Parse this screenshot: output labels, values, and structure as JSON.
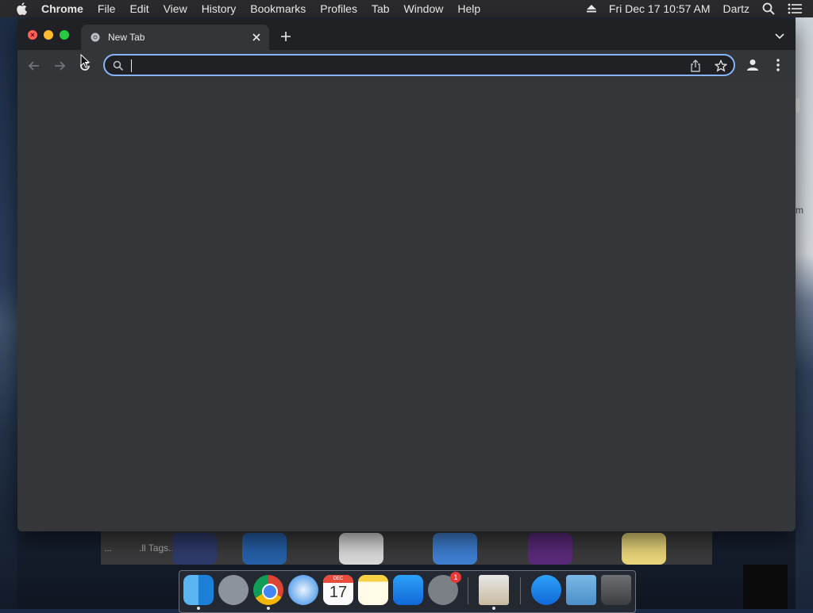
{
  "menubar": {
    "app": "Chrome",
    "items": [
      "File",
      "Edit",
      "View",
      "History",
      "Bookmarks",
      "Profiles",
      "Tab",
      "Window",
      "Help"
    ],
    "clock": "Fri Dec 17  10:57 AM",
    "user": "Dartz"
  },
  "browser": {
    "tab_title": "New Tab",
    "address_value": "",
    "accent_color": "#8ab4f8"
  },
  "background_window": {
    "label1": "...",
    "label2": ".ll Tags..."
  },
  "desktop": {
    "right_text": "m"
  },
  "dock": {
    "items": [
      "finder-icon",
      "launchpad-icon",
      "chrome-icon",
      "safari-icon",
      "calendar-icon",
      "notes-icon",
      "app-store-icon",
      "system-preferences-icon",
      "document-icon",
      "app-store-folder-icon",
      "folder-icon",
      "trash-icon"
    ],
    "calendar_month": "DEC",
    "calendar_day": "17",
    "preferences_badge": "1"
  }
}
